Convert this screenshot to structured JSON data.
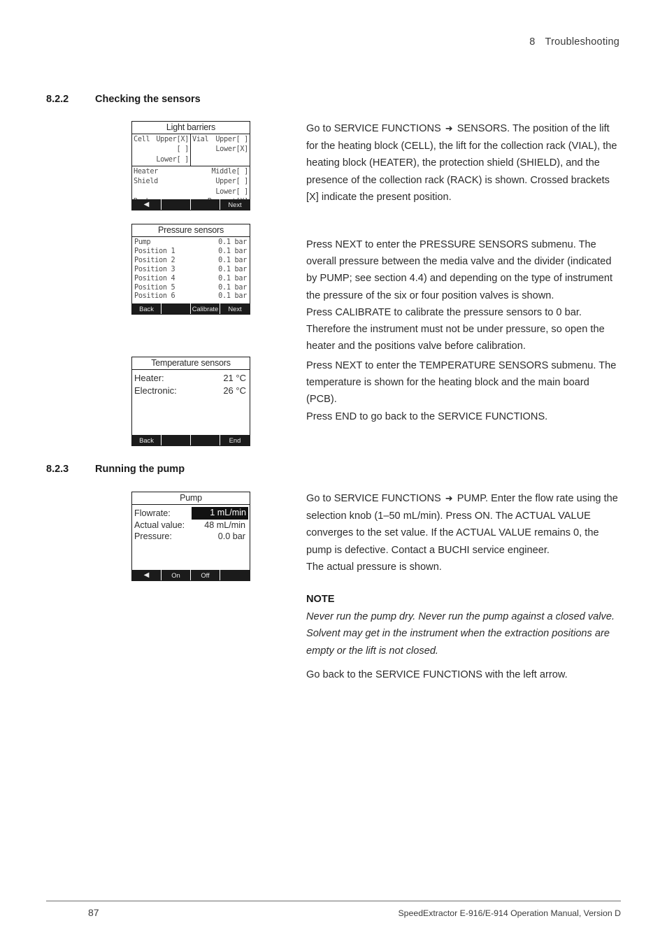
{
  "header": {
    "chapter_number": "8",
    "chapter_title": "Troubleshooting"
  },
  "sections": {
    "s222": {
      "number": "8.2.2",
      "title": "Checking the sensors"
    },
    "s223": {
      "number": "8.2.3",
      "title": "Running the pump"
    }
  },
  "paragraphs": {
    "sensors": "Go to SERVICE FUNCTIONS ➜ SENSORS. The position of the lift for the heating block (CELL), the lift for the collection rack (VIAL), the heating block (HEATER), the protection shield (SHIELD), and the presence of the collection rack (RACK) is shown. Crossed brackets [X] indicate the present position.",
    "pressure": "Press NEXT to enter the PRESSURE SENSORS submenu. The overall pressure between the media valve and the divider (indicated by PUMP; see section 4.4) and depending on the type of instrument the pressure of the six or four position valves is shown.\nPress CALIBRATE to calibrate the pressure sensors to 0 bar. Therefore the instrument must not be under pressure, so open the heater and the positions valve before calibration.",
    "temperature": "Press NEXT to enter the TEMPERATURE SENSORS submenu. The temperature is shown for the heating block and the main board (PCB).\nPress END to go back to the SERVICE FUNCTIONS.",
    "pump": "Go to SERVICE FUNCTIONS ➜ PUMP. Enter the flow rate using the selection knob (1–50 mL/min). Press ON. The ACTUAL VALUE converges to the set value. If the ACTUAL VALUE remains 0, the pump is defective. Contact a BUCHI service engineer.\nThe actual pressure is shown.",
    "note_title": "NOTE",
    "note_body": "Never run the pump dry. Never run the pump against a closed valve. Solvent may get in the instrument when the extraction positions are empty or the lift is not closed.",
    "go_back": "Go back to the SERVICE FUNCTIONS with the left arrow."
  },
  "screens": {
    "light_barriers": {
      "title": "Light barriers",
      "cell": {
        "name": "Cell",
        "rows": [
          {
            "label": "Upper",
            "state": "[X]"
          },
          {
            "label": "",
            "state": "[ ]"
          },
          {
            "label": "Lower",
            "state": "[ ]"
          }
        ]
      },
      "vial": {
        "name": "Vial",
        "rows": [
          {
            "label": "Upper",
            "state": "[ ]"
          },
          {
            "label": "",
            "state": ""
          },
          {
            "label": "Lower",
            "state": "[X]"
          }
        ]
      },
      "lower": [
        {
          "name": "Heater",
          "label": "Middle",
          "state": "[ ]"
        },
        {
          "name": "Shield",
          "label": "Upper",
          "state": "[ ]"
        },
        {
          "name": "",
          "label": "Lower",
          "state": "[ ]"
        },
        {
          "name": "Rack",
          "label": "Present",
          "state": "[X]"
        }
      ],
      "softkeys": [
        "◀",
        "",
        "",
        "Next"
      ]
    },
    "pressure_sensors": {
      "title": "Pressure sensors",
      "rows": [
        {
          "label": "Pump",
          "value": "0.1 bar"
        },
        {
          "label": "Position 1",
          "value": "0.1 bar"
        },
        {
          "label": "Position 2",
          "value": "0.1 bar"
        },
        {
          "label": "Position 3",
          "value": "0.1 bar"
        },
        {
          "label": "Position 4",
          "value": "0.1 bar"
        },
        {
          "label": "Position 5",
          "value": "0.1 bar"
        },
        {
          "label": "Position 6",
          "value": "0.1 bar"
        }
      ],
      "softkeys": [
        "Back",
        "",
        "Calibrate",
        "Next"
      ]
    },
    "temperature_sensors": {
      "title": "Temperature sensors",
      "rows": [
        {
          "label": "Heater:",
          "value": "21 °C"
        },
        {
          "label": "Electronic:",
          "value": "26 °C"
        }
      ],
      "softkeys": [
        "Back",
        "",
        "",
        "End"
      ]
    },
    "pump": {
      "title": "Pump",
      "rows": [
        {
          "label": "Flowrate:",
          "value": "1 mL/min",
          "highlighted": true
        },
        {
          "label": "Actual value:",
          "value": "48 mL/min",
          "highlighted": false
        },
        {
          "label": "Pressure:",
          "value": "0.0 bar",
          "highlighted": false
        }
      ],
      "softkeys": [
        "◀",
        "On",
        "Off",
        ""
      ]
    }
  },
  "footer": {
    "page_number": "87",
    "document": "SpeedExtractor E-916/E-914 Operation Manual, Version D"
  }
}
